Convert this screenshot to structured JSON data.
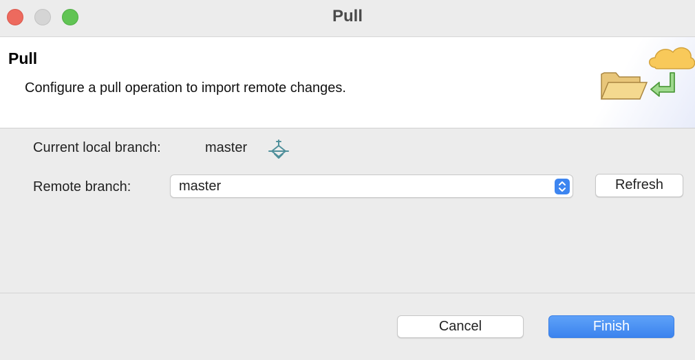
{
  "window": {
    "title": "Pull"
  },
  "header": {
    "title": "Pull",
    "description": "Configure a pull operation to import remote changes."
  },
  "form": {
    "current_branch_label": "Current local branch:",
    "current_branch_value": "master",
    "remote_branch_label": "Remote branch:",
    "remote_branch_selected": "master",
    "refresh_label": "Refresh"
  },
  "footer": {
    "cancel_label": "Cancel",
    "finish_label": "Finish"
  },
  "colors": {
    "accent": "#3b83ee",
    "close": "#ed6a5e",
    "minimize": "#d5d5d5",
    "zoom": "#61c454"
  },
  "icons": {
    "wizard": "pull-wizard-icon",
    "branch": "branch-icon",
    "stepper": "chevron-updown-icon"
  }
}
